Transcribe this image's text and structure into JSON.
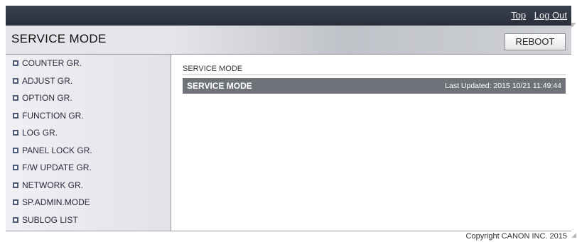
{
  "header_links": {
    "top": "Top",
    "logout": "Log Out"
  },
  "header": {
    "title": "SERVICE MODE",
    "reboot_label": "REBOOT"
  },
  "sidebar": {
    "items": [
      {
        "label": "COUNTER GR."
      },
      {
        "label": "ADJUST GR."
      },
      {
        "label": "OPTION GR."
      },
      {
        "label": "FUNCTION GR."
      },
      {
        "label": "LOG GR."
      },
      {
        "label": "PANEL LOCK GR."
      },
      {
        "label": "F/W UPDATE GR."
      },
      {
        "label": "NETWORK GR."
      },
      {
        "label": "SP.ADMIN.MODE"
      },
      {
        "label": "SUBLOG LIST"
      }
    ]
  },
  "main": {
    "breadcrumb": "SERVICE MODE",
    "title": "SERVICE MODE",
    "last_updated": "Last Updated: 2015 10/21 11:49:44"
  },
  "footer": {
    "copyright": "Copyright CANON INC. 2015"
  }
}
